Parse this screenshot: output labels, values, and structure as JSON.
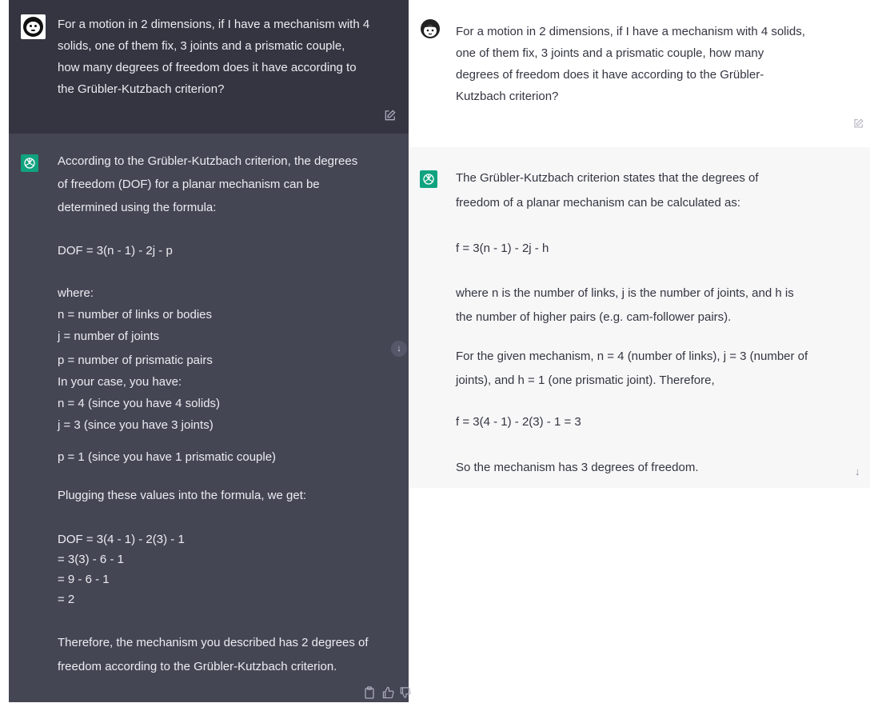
{
  "left": {
    "user_message": [
      "For a motion in 2 dimensions, if I have a mechanism with 4",
      "solids, one of them fix, 3 joints and a prismatic couple,",
      "how many degrees of freedom does it have according to",
      "the Grübler-Kutzbach criterion?"
    ],
    "assistant_lines": [
      "According to the Grübler-Kutzbach criterion, the degrees",
      "of freedom (DOF) for a planar mechanism can be",
      "determined using the formula:",
      "DOF = 3(n - 1) - 2j - p",
      "where:",
      "n = number of links or bodies",
      "j = number of joints",
      "p = number of prismatic pairs",
      "In your case, you have:",
      "n = 4 (since you have 4 solids)",
      "j = 3 (since you have 3 joints)",
      "p = 1 (since you have 1 prismatic couple)",
      "Plugging these values into the formula, we get:",
      "DOF = 3(4 - 1) - 2(3) - 1",
      "= 3(3) - 6 - 1",
      "= 9 - 6 - 1",
      "= 2",
      "Therefore, the mechanism you described has 2 degrees of",
      "freedom according to the Grübler-Kutzbach criterion."
    ],
    "icons": {
      "edit": "edit-icon",
      "scroll": "arrow-down-icon",
      "copy": "clipboard-icon",
      "like": "thumbs-up-icon",
      "dislike": "thumbs-down-icon"
    },
    "colors": {
      "user_bg": "#343541",
      "assistant_bg": "#444654",
      "accent": "#10a37f"
    }
  },
  "right": {
    "user_message": [
      "For a motion in 2 dimensions, if I have a mechanism with 4 solids,",
      "one of them fix, 3 joints and a prismatic couple, how many",
      "degrees of freedom does it have according to the Grübler-",
      "Kutzbach criterion?"
    ],
    "assistant_lines": [
      "The Grübler-Kutzbach criterion states that the degrees of",
      "freedom of a planar mechanism can be calculated as:",
      "f = 3(n - 1) - 2j - h",
      "where n is the number of links, j is the number of joints, and h is",
      "the number of higher pairs (e.g. cam-follower pairs).",
      "For the given mechanism, n = 4 (number of links), j = 3 (number of",
      "joints), and h = 1 (one prismatic joint). Therefore,",
      "f = 3(4 - 1) - 2(3) - 1 = 3",
      "So the mechanism has 3 degrees of freedom."
    ],
    "icons": {
      "edit": "edit-icon",
      "scroll": "arrow-down-icon"
    },
    "colors": {
      "user_bg": "#ffffff",
      "assistant_bg": "#f7f7f8",
      "accent": "#10a37f"
    }
  }
}
